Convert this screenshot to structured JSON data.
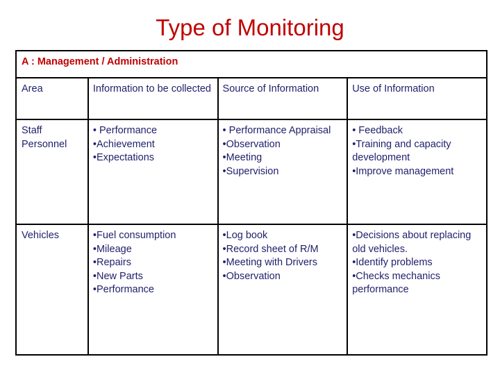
{
  "slide": {
    "title": "Type of Monitoring",
    "title_color": "#C00000",
    "body_text_color": "#1F1F6B",
    "border_color": "#000000",
    "background_color": "#FFFFFF"
  },
  "table": {
    "section_banner": "A : Management / Administration",
    "columns": [
      "Area",
      "Information to be collected",
      "Source of Information",
      "Use of Information"
    ],
    "rows": [
      {
        "area": "Staff Personnel",
        "information_to_be_collected": [
          "• Performance",
          "•Achievement",
          "•Expectations"
        ],
        "source_of_information": [
          "• Performance Appraisal",
          "•Observation",
          "•Meeting",
          "•Supervision"
        ],
        "use_of_information": [
          "• Feedback",
          "•Training and capacity development",
          "•Improve management"
        ]
      },
      {
        "area": "Vehicles",
        "information_to_be_collected": [
          "•Fuel consumption",
          "•Mileage",
          "•Repairs",
          "•New Parts",
          "•Performance"
        ],
        "source_of_information": [
          "•Log book",
          "•Record sheet of R/M",
          "•Meeting with Drivers",
          "•Observation"
        ],
        "use_of_information": [
          "•Decisions about replacing old vehicles.",
          "•Identify problems",
          "•Checks mechanics performance"
        ]
      }
    ]
  }
}
